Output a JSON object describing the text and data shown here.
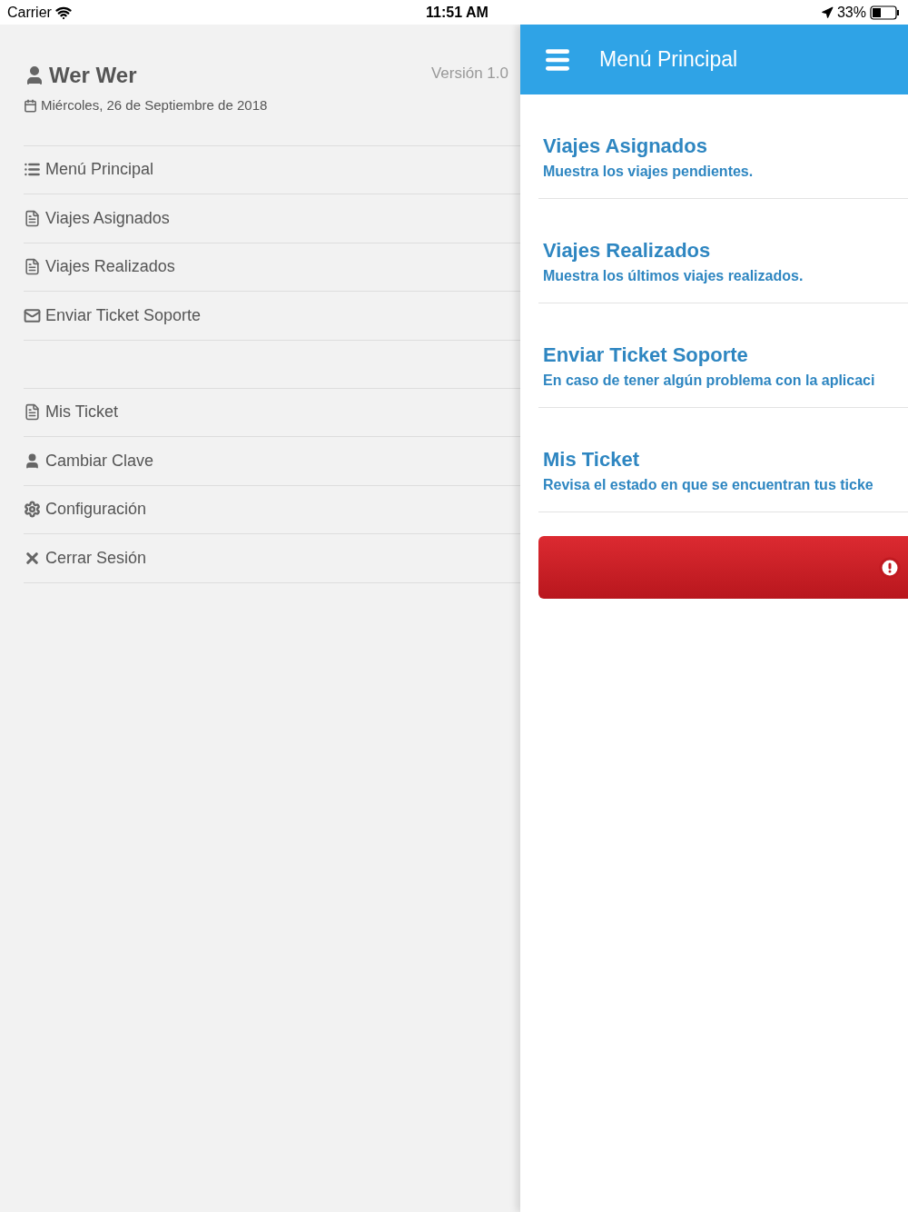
{
  "status_bar": {
    "carrier": "Carrier",
    "time": "11:51 AM",
    "battery": "33%"
  },
  "sidebar": {
    "user_name": "Wer Wer",
    "version": "Versión 1.0",
    "date": "Miércoles, 26 de Septiembre de 2018",
    "groups": [
      [
        {
          "kind": "list",
          "label": "Menú Principal"
        },
        {
          "kind": "doc",
          "label": "Viajes Asignados"
        },
        {
          "kind": "doc",
          "label": "Viajes Realizados"
        },
        {
          "kind": "envelope",
          "label": "Enviar Ticket Soporte"
        }
      ],
      [
        {
          "kind": "doc",
          "label": "Mis Ticket"
        },
        {
          "kind": "user",
          "label": "Cambiar Clave"
        },
        {
          "kind": "gear",
          "label": "Configuración"
        },
        {
          "kind": "close",
          "label": "Cerrar Sesión"
        }
      ]
    ]
  },
  "header": {
    "title": "Menú Principal"
  },
  "menu": [
    {
      "title": "Viajes Asignados",
      "subtitle": "Muestra los viajes pendientes."
    },
    {
      "title": "Viajes Realizados",
      "subtitle": "Muestra los últimos viajes realizados."
    },
    {
      "title": "Enviar Ticket Soporte",
      "subtitle": "En caso de tener algún problema con la aplicaci"
    },
    {
      "title": "Mis Ticket",
      "subtitle": "Revisa el estado en que se encuentran tus ticke"
    }
  ],
  "alert_button": {
    "kind": "alert"
  }
}
